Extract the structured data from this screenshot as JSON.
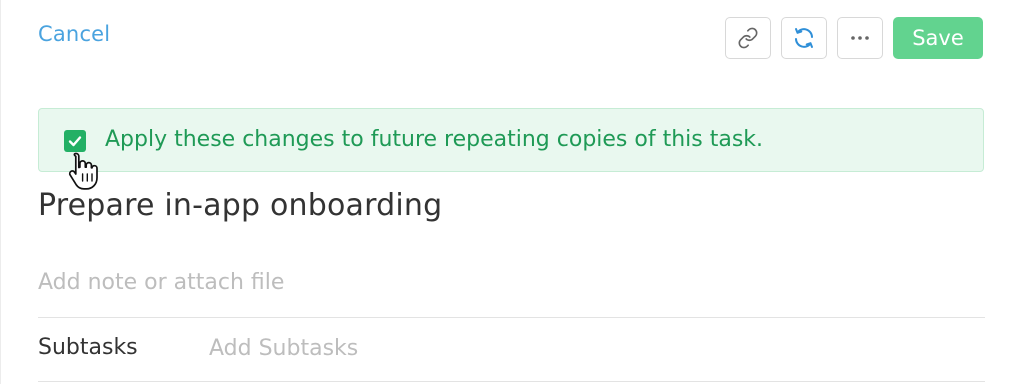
{
  "header": {
    "cancel_label": "Cancel",
    "save_label": "Save",
    "icons": [
      "link-icon",
      "repeat-icon",
      "more-icon"
    ]
  },
  "banner": {
    "checked": true,
    "text": "Apply these changes to future repeating copies of this task."
  },
  "task": {
    "title": "Prepare in-app onboarding",
    "note_placeholder": "Add note or attach file"
  },
  "subtasks": {
    "label": "Subtasks",
    "placeholder": "Add Subtasks"
  },
  "colors": {
    "accent_blue": "#4aa3df",
    "save_green": "#62d38f",
    "banner_bg": "#e9f8ef",
    "banner_text": "#1f9a56",
    "checkbox_green": "#23b065"
  }
}
